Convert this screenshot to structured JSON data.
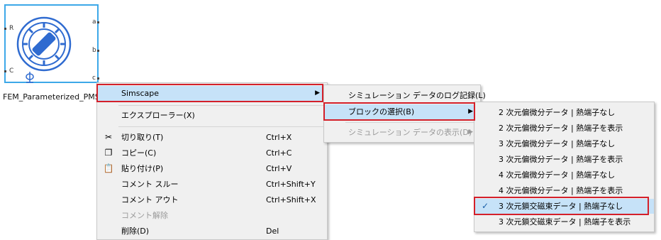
{
  "block": {
    "name": "FEM_Parameterized_PMSM",
    "ports": {
      "left": [
        "R",
        "C"
      ],
      "right": [
        "a",
        "b",
        "c"
      ]
    }
  },
  "context_menu": {
    "items": [
      {
        "label": "Simscape",
        "submenu": true
      },
      {
        "label": "エクスプローラー(X)"
      },
      {
        "label": "切り取り(T)",
        "shortcut": "Ctrl+X",
        "icon": "scissors-icon"
      },
      {
        "label": "コピー(C)",
        "shortcut": "Ctrl+C",
        "icon": "copy-icon"
      },
      {
        "label": "貼り付け(P)",
        "shortcut": "Ctrl+V",
        "icon": "paste-icon"
      },
      {
        "label": "コメント スルー",
        "shortcut": "Ctrl+Shift+Y"
      },
      {
        "label": "コメント アウト",
        "shortcut": "Ctrl+Shift+X"
      },
      {
        "label": "コメント解除",
        "disabled": true
      },
      {
        "label": "削除(D)",
        "shortcut": "Del"
      }
    ]
  },
  "simscape_menu": {
    "items": [
      {
        "label": "シミュレーション データのログ記録(L)"
      },
      {
        "label": "ブロックの選択(B)",
        "submenu": true
      },
      {
        "label": "シミュレーション データの表示(D)",
        "submenu": true,
        "disabled": true
      }
    ]
  },
  "variant_menu": {
    "items": [
      {
        "label": "2 次元偏微分データ | 熱端子なし"
      },
      {
        "label": "2 次元偏微分データ | 熱端子を表示"
      },
      {
        "label": "3 次元偏微分データ | 熱端子なし"
      },
      {
        "label": "3 次元偏微分データ | 熱端子を表示"
      },
      {
        "label": "4 次元偏微分データ | 熱端子なし"
      },
      {
        "label": "4 次元偏微分データ | 熱端子を表示"
      },
      {
        "label": "3 次元鎖交磁束データ | 熱端子なし",
        "checked": true
      },
      {
        "label": "3 次元鎖交磁束データ | 熱端子を表示"
      }
    ]
  },
  "colors": {
    "highlight": "#c6e2f8",
    "callout": "#d4202a",
    "block_border": "#3da8e8"
  }
}
